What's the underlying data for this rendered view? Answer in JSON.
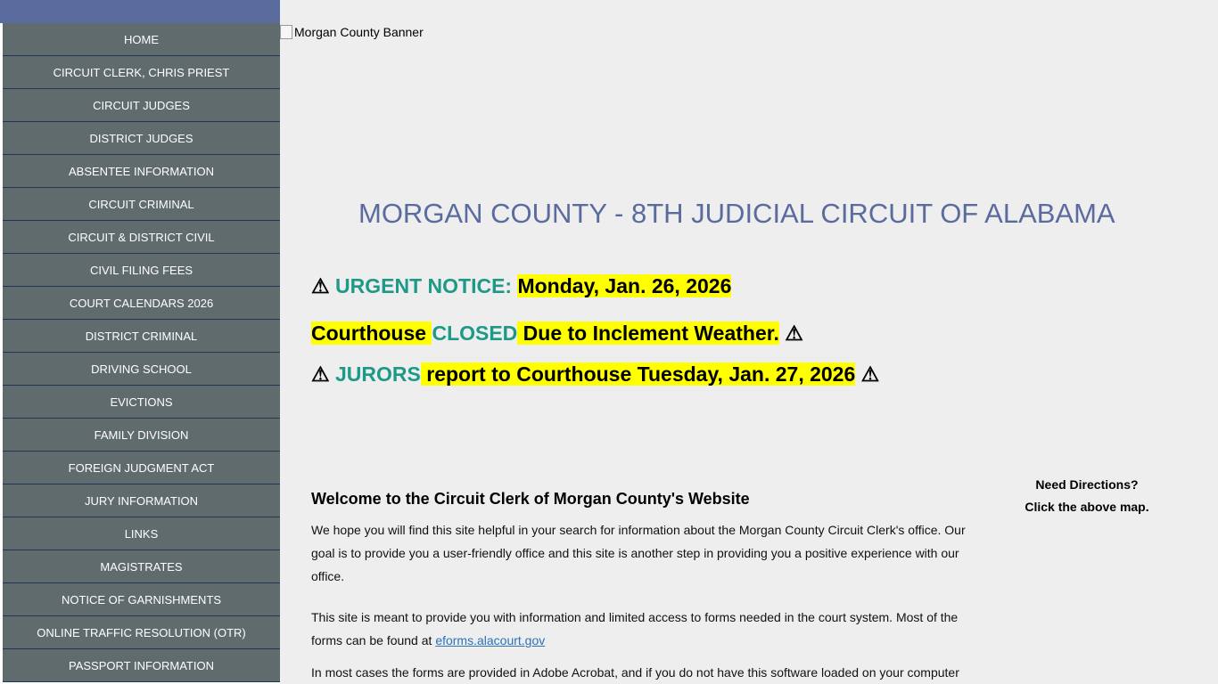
{
  "sidebar": {
    "items": [
      {
        "label": "HOME"
      },
      {
        "label": "CIRCUIT CLERK, CHRIS PRIEST"
      },
      {
        "label": "CIRCUIT JUDGES"
      },
      {
        "label": "DISTRICT JUDGES"
      },
      {
        "label": "ABSENTEE INFORMATION"
      },
      {
        "label": "CIRCUIT CRIMINAL"
      },
      {
        "label": "CIRCUIT & DISTRICT CIVIL"
      },
      {
        "label": "CIVIL FILING FEES"
      },
      {
        "label": "COURT CALENDARS 2026"
      },
      {
        "label": "DISTRICT CRIMINAL"
      },
      {
        "label": "DRIVING SCHOOL"
      },
      {
        "label": "EVICTIONS"
      },
      {
        "label": "FAMILY DIVISION"
      },
      {
        "label": "FOREIGN JUDGMENT ACT"
      },
      {
        "label": "JURY INFORMATION"
      },
      {
        "label": "LINKS"
      },
      {
        "label": "MAGISTRATES"
      },
      {
        "label": "NOTICE OF GARNISHMENTS"
      },
      {
        "label": "ONLINE TRAFFIC RESOLUTION (OTR)"
      },
      {
        "label": "PASSPORT INFORMATION"
      }
    ]
  },
  "banner": {
    "alt": "Morgan County Banner"
  },
  "title": "MORGAN COUNTY - 8TH JUDICIAL CIRCUIT OF ALABAMA",
  "notice": {
    "warn": "⚠",
    "line1_label": "URGENT NOTICE:",
    "line1_date": "Monday, Jan. 26, 2026",
    "line2_a": "Courthouse ",
    "line2_closed": "CLOSED",
    "line2_b": " Due to Inclement Weather.",
    "line3_jurors": "JURORS",
    "line3_text": " report to Courthouse Tuesday, Jan. 27, 2026"
  },
  "welcome": {
    "title": "Welcome to the Circuit Clerk of Morgan County's Website",
    "p1": "We hope you will find this site helpful in your search for information about the Morgan County Circuit Clerk's office. Our goal is to provide you a user-friendly office and this site is another step in providing you a positive experience with our office.",
    "p2_text": "This site is meant to provide you with information and limited access to forms needed in the court system. Most of the forms can be found at ",
    "p2_link": "eforms.alacourt.gov",
    "p3": "In most cases the forms are provided in Adobe Acrobat, and if you do not have this software loaded on your computer"
  },
  "directions": {
    "line1": "Need Directions?",
    "line2": "Click the above map."
  },
  "colors": {
    "sidebar_top": "#5a6b9e",
    "nav_bg": "#606b6e",
    "nav_border": "#20355a",
    "title": "#5a6b9e",
    "teal": "#1d9a87",
    "highlight": "#ffff00",
    "link": "#2b72b8"
  },
  "icons": [
    "warning-icon"
  ]
}
